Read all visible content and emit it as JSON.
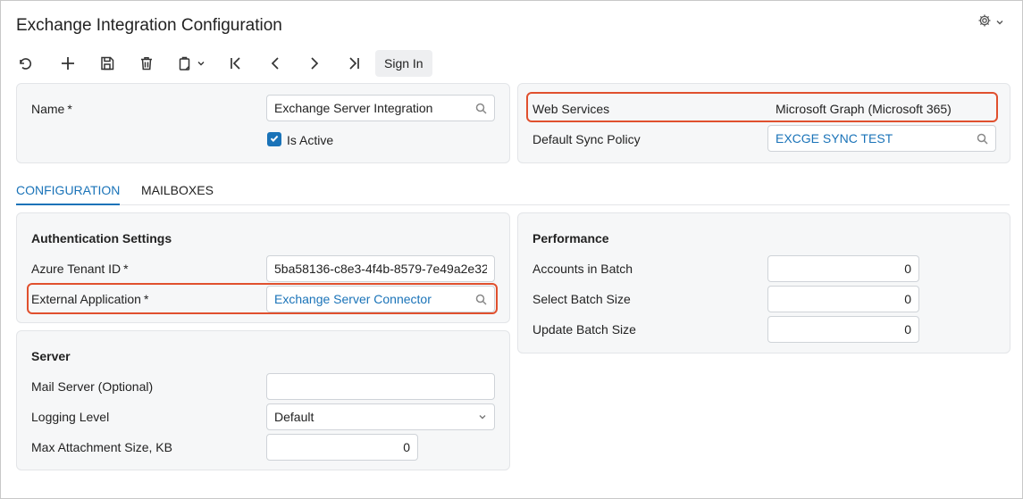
{
  "page": {
    "title": "Exchange Integration Configuration"
  },
  "toolbar": {
    "sign_in_label": "Sign In"
  },
  "summary": {
    "name_label": "Name",
    "required_mark": "*",
    "name_value": "Exchange Server Integration",
    "is_active_label": "Is Active",
    "is_active_checked": true,
    "web_services_label": "Web Services",
    "web_services_value": "Microsoft Graph (Microsoft 365)",
    "default_sync_policy_label": "Default Sync Policy",
    "default_sync_policy_value": "EXCGE SYNC TEST"
  },
  "tabs": [
    {
      "label": "CONFIGURATION",
      "active": true
    },
    {
      "label": "MAILBOXES",
      "active": false
    }
  ],
  "auth": {
    "title": "Authentication Settings",
    "tenant_label": "Azure Tenant ID",
    "tenant_value": "5ba58136-c8e3-4f4b-8579-7e49a2e32",
    "external_app_label": "External Application",
    "external_app_value": "Exchange Server Connector"
  },
  "server": {
    "title": "Server",
    "mail_server_label": "Mail Server (Optional)",
    "mail_server_value": "",
    "logging_level_label": "Logging Level",
    "logging_level_value": "Default",
    "max_attachment_label": "Max Attachment Size, KB",
    "max_attachment_value": "0"
  },
  "performance": {
    "title": "Performance",
    "accounts_label": "Accounts in Batch",
    "accounts_value": "0",
    "select_label": "Select Batch Size",
    "select_value": "0",
    "update_label": "Update Batch Size",
    "update_value": "0"
  },
  "colors": {
    "accent": "#1a73b8",
    "highlight": "#e0502e",
    "panel_bg": "#f6f7f8"
  },
  "icons": [
    "settings-gear-icon",
    "undo-icon",
    "add-icon",
    "save-icon",
    "delete-icon",
    "copy-paste-icon",
    "first-record-icon",
    "previous-record-icon",
    "next-record-icon",
    "last-record-icon",
    "search-icon",
    "chevron-down-icon",
    "checkmark-icon"
  ]
}
